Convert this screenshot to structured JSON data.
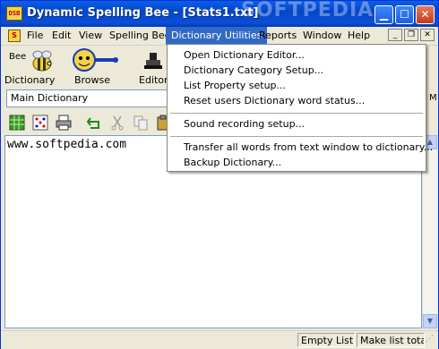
{
  "window": {
    "title": "Dynamic Spelling Bee - [Stats1.txt]",
    "app_icon_text": "DSB",
    "watermark": "SOFTPEDIA"
  },
  "menubar": {
    "items": [
      "File",
      "Edit",
      "View",
      "Spelling Bee",
      "Dictionary Utilities",
      "Reports",
      "Window",
      "Help"
    ],
    "active": "Dictionary Utilities"
  },
  "toolbar_big": {
    "items": [
      {
        "top": "Bee",
        "label": "Dictionary",
        "icon": "bee-icon"
      },
      {
        "label": "Browse",
        "icon": "magnifier-bee-icon"
      },
      {
        "label": "Editor",
        "icon": "stamp-icon"
      }
    ]
  },
  "dictionary_select": {
    "value": "Main Dictionary"
  },
  "dictionary_select_tail": "M",
  "toolbar_small": {
    "icons": [
      "grid-icon",
      "dice-icon",
      "print-icon",
      "undo-icon",
      "cut-icon",
      "copy-icon",
      "paste-icon"
    ]
  },
  "editor": {
    "content": "www.softpedia.com"
  },
  "dropdown_menu": {
    "items": [
      "Open Dictionary Editor...",
      "Dictionary Category Setup...",
      "List Property setup...",
      "Reset users Dictionary word status...",
      "Sound recording setup...",
      "Transfer all words from text window to dictionary...",
      "Backup Dictionary..."
    ]
  },
  "statusbar": {
    "panels": [
      "Empty List",
      "Make list total"
    ]
  },
  "colors": {
    "titlebar": "#0a4fd6",
    "menu_highlight": "#316ac5",
    "face": "#ece9d8"
  }
}
